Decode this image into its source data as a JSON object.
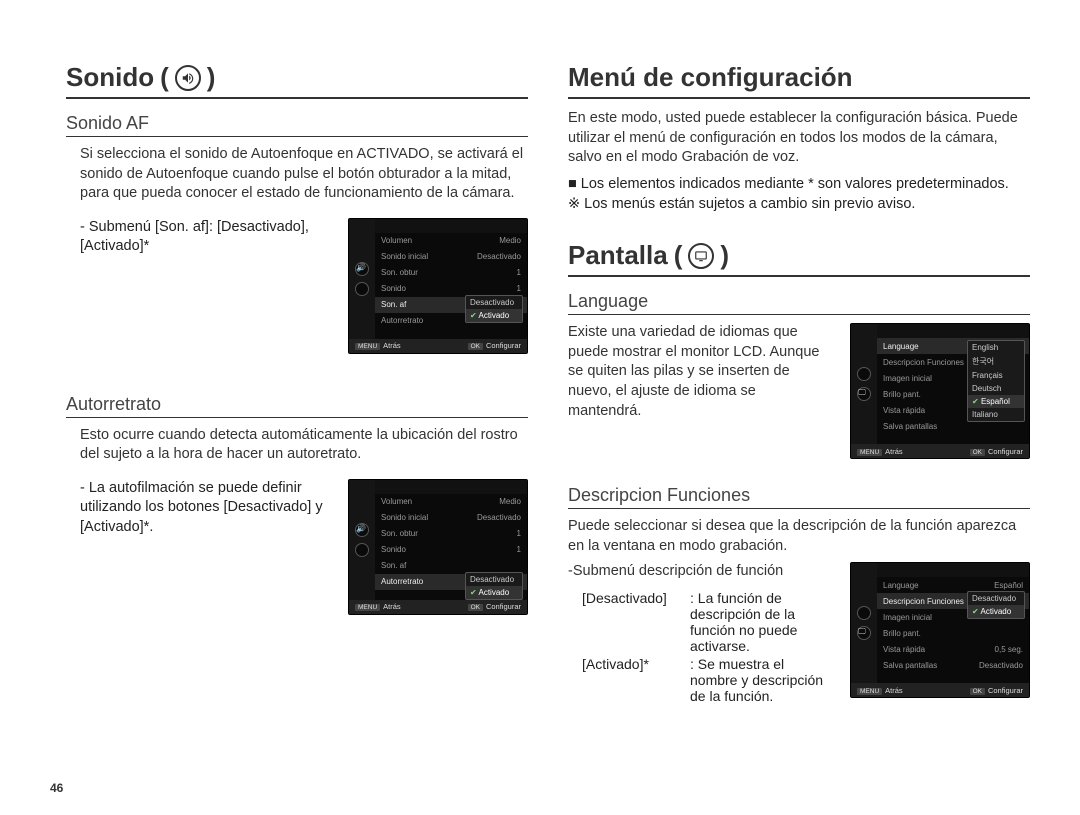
{
  "page_number": "46",
  "left": {
    "title": "Sonido",
    "sec1": {
      "heading": "Sonido AF",
      "body": "Si selecciona el sonido de Autoenfoque en ACTIVADO, se activará el sonido de Autoenfoque cuando pulse el botón obturador a la mitad, para que pueda conocer el estado de funcionamiento de la cámara.",
      "sub": "- Submenú [Son. af]: [Desactivado], [Activado]*"
    },
    "sec2": {
      "heading": "Autorretrato",
      "body": "Esto ocurre cuando detecta automáticamente la ubicación del rostro del sujeto a la hora de hacer un autoretrato.",
      "sub": "- La autofilmación se puede definir utilizando los botones [Desactivado] y [Activado]*."
    }
  },
  "right": {
    "title1": "Menú de configuración",
    "intro1": "En este modo, usted puede establecer la configuración básica. Puede utilizar el menú de configuración en todos los modos de la cámara, salvo en el modo Grabación de voz.",
    "bullet1": "Los elementos indicados mediante * son valores predeterminados.",
    "note": "※ Los menús están sujetos a cambio sin previo aviso.",
    "title2": "Pantalla",
    "sec1": {
      "heading": "Language",
      "body": "Existe una variedad de idiomas que puede mostrar el monitor LCD. Aunque se quiten las pilas y se inserten de nuevo, el ajuste de idioma se mantendrá."
    },
    "sec2": {
      "heading": "Descripcion Funciones",
      "body": "Puede seleccionar si desea que la descripción de la función aparezca en la ventana en modo grabación.",
      "sub_h": "-Submenú descripción de función",
      "def1_k": "[Desactivado]",
      "def1_v": ": La función de descripción de la función no puede activarse.",
      "def2_k": "[Activado]*",
      "def2_v": ": Se muestra el nombre y descripción de la función."
    }
  },
  "lcd_sound": {
    "rows": [
      {
        "l": "Volumen",
        "r": "Medio"
      },
      {
        "l": "Sonido inicial",
        "r": "Desactivado"
      },
      {
        "l": "Son. obtur",
        "r": "1"
      },
      {
        "l": "Sonido",
        "r": "1"
      },
      {
        "l": "Son. af",
        "r": ""
      },
      {
        "l": "Autorretrato",
        "r": ""
      }
    ],
    "opts": [
      "Desactivado",
      "Activado"
    ],
    "foot_back_btn": "MENU",
    "foot_back": "Atrás",
    "foot_ok_btn": "OK",
    "foot_ok": "Configurar"
  },
  "lcd_lang": {
    "rows": [
      {
        "l": "Language",
        "r": ""
      },
      {
        "l": "Descripcion Funciones",
        "r": ""
      },
      {
        "l": "Imagen inicial",
        "r": ""
      },
      {
        "l": "Brillo pant.",
        "r": ""
      },
      {
        "l": "Vista rápida",
        "r": ""
      },
      {
        "l": "Salva pantallas",
        "r": ""
      }
    ],
    "opts": [
      "English",
      "한국어",
      "Français",
      "Deutsch",
      "Español",
      "Italiano"
    ],
    "foot_back_btn": "MENU",
    "foot_back": "Atrás",
    "foot_ok_btn": "OK",
    "foot_ok": "Configurar"
  },
  "lcd_desc": {
    "rows": [
      {
        "l": "Language",
        "r": "Español"
      },
      {
        "l": "Descripcion Funciones",
        "r": ""
      },
      {
        "l": "Imagen inicial",
        "r": ""
      },
      {
        "l": "Brillo pant.",
        "r": ""
      },
      {
        "l": "Vista rápida",
        "r": "0,5 seg."
      },
      {
        "l": "Salva pantallas",
        "r": "Desactivado"
      }
    ],
    "opts": [
      "Desactivado",
      "Activado"
    ],
    "foot_back_btn": "MENU",
    "foot_back": "Atrás",
    "foot_ok_btn": "OK",
    "foot_ok": "Configurar"
  }
}
